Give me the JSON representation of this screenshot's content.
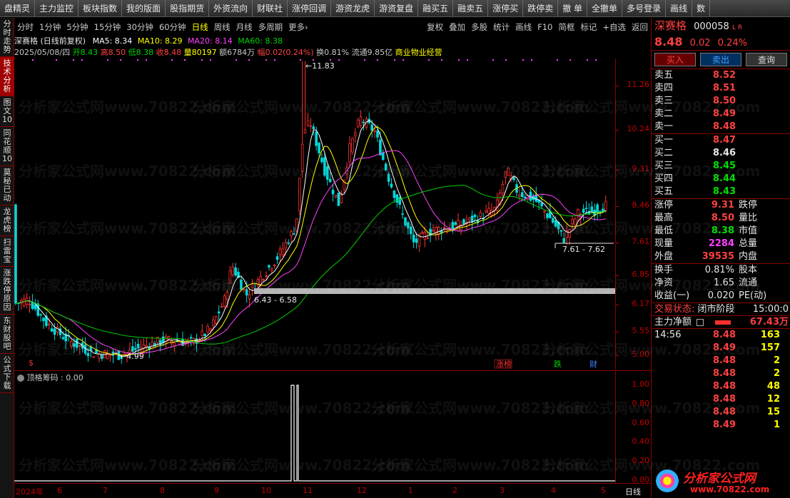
{
  "topbar": [
    "盘精灵",
    "主力监控",
    "板块指数",
    "我的版面",
    "股指期货",
    "外资流向",
    "财联社",
    "涨停回调",
    "游资龙虎",
    "游资复盘",
    "融买五",
    "融卖五",
    "涨停买",
    "跌停卖",
    "撤 单",
    "全撤单",
    "多号登录",
    "画线",
    "数"
  ],
  "leftnav": [
    "分时走势",
    "技术分析",
    "图文10",
    "同花顺10",
    "莫秘已动",
    "龙虎榜",
    "扫雷宝",
    "涨跌停原因",
    "东财股吧",
    "公式下载"
  ],
  "periods": [
    "分时",
    "1分钟",
    "5分钟",
    "15分钟",
    "30分钟",
    "60分钟",
    "日线",
    "周线",
    "月线",
    "多周期",
    "更多›",
    "复权",
    "叠加",
    "多股",
    "统计",
    "画线",
    "F10",
    "简框",
    "标记",
    "+自选",
    "返回"
  ],
  "active_period": "日线",
  "stock": {
    "name": "深赛格",
    "code": "000058",
    "tag": "L R",
    "mode": "(日线前复权)",
    "price": "8.48",
    "change": "0.02",
    "pct": "0.24%"
  },
  "ma": {
    "ma5": "MA5: 8.34",
    "ma10": "MA10: 8.29",
    "ma20": "MA20: 8.14",
    "ma60": "MA60: 8.38"
  },
  "dayinfo": {
    "date": "2025/05/08/四",
    "open": "开8.43",
    "high": "高8.50",
    "low": "低8.38",
    "close": "收8.48",
    "vol": "量80197",
    "amt": "额6784万",
    "amp": "幅0.02(0.24%)",
    "turn": "换0.81%",
    "float": "流通9.85亿",
    "sector": "商业物业经营"
  },
  "price_axis": [
    "11.26",
    "10.24",
    "9.31",
    "8.46",
    "7.61",
    "6.85",
    "6.17",
    "5.55",
    "5.00"
  ],
  "annotations": {
    "max": "11.83",
    "min": "4.99",
    "range1": "7.61 - 7.62",
    "range2": "6.43 - 6.58",
    "mark_s": "$",
    "tag_zhang": "涨榜",
    "tag_die": "跌",
    "tag_cai": "财"
  },
  "indicator": {
    "name": "顶格筹码 : 0.00",
    "axis": [
      "1.00",
      "0.80",
      "0.60",
      "0.40",
      "0.20",
      "0.00"
    ]
  },
  "date_axis": [
    "2024年",
    "6",
    "7",
    "8",
    "9",
    "10",
    "11",
    "12",
    "1",
    "2",
    "3",
    "4",
    "5"
  ],
  "period_label": "日线",
  "trade_buttons": [
    "买入",
    "卖出",
    "查询"
  ],
  "orderbook": {
    "asks": [
      [
        "卖五",
        "8.52"
      ],
      [
        "卖四",
        "8.51"
      ],
      [
        "卖三",
        "8.50"
      ],
      [
        "卖二",
        "8.49"
      ],
      [
        "卖一",
        "8.48"
      ]
    ],
    "bids": [
      [
        "买一",
        "8.47"
      ],
      [
        "买二",
        "8.46"
      ],
      [
        "买三",
        "8.45"
      ],
      [
        "买四",
        "8.44"
      ],
      [
        "买五",
        "8.43"
      ]
    ]
  },
  "stats": [
    [
      "涨停",
      "9.31",
      "跌停",
      ""
    ],
    [
      "最高",
      "8.50",
      "量比",
      ""
    ],
    [
      "最低",
      "8.38",
      "市值",
      ""
    ],
    [
      "现量",
      "2284",
      "总量",
      ""
    ],
    [
      "外盘",
      "39535",
      "内盘",
      ""
    ]
  ],
  "stats2": [
    [
      "换手",
      "0.81%",
      "股本"
    ],
    [
      "净资",
      "1.65",
      "流通"
    ],
    [
      "收益(一)",
      "0.020",
      "PE(动)"
    ]
  ],
  "trade_status": {
    "label": "交易状态:",
    "value": "闭市阶段",
    "time": "15:00:0"
  },
  "main_net": {
    "label": "主力净额",
    "value": "67.43万"
  },
  "ticks": [
    [
      "14:56",
      "8.48",
      "163"
    ],
    [
      "",
      "8.49",
      "157"
    ],
    [
      "",
      "8.48",
      "2"
    ],
    [
      "",
      "8.48",
      "2"
    ],
    [
      "",
      "8.48",
      "48"
    ],
    [
      "",
      "8.48",
      "12"
    ],
    [
      "",
      "8.48",
      "15"
    ],
    [
      "",
      "8.49",
      "1"
    ]
  ],
  "watermark": "分析家公式网www.70822.com",
  "logo": {
    "title": "分析家公式网",
    "url": "www.70822.com"
  },
  "colors": {
    "up": "#ff3030",
    "down": "#00d8d8",
    "ma5": "#ffffff",
    "ma10": "#ffff00",
    "ma20": "#ff40ff",
    "ma60": "#00d000"
  }
}
